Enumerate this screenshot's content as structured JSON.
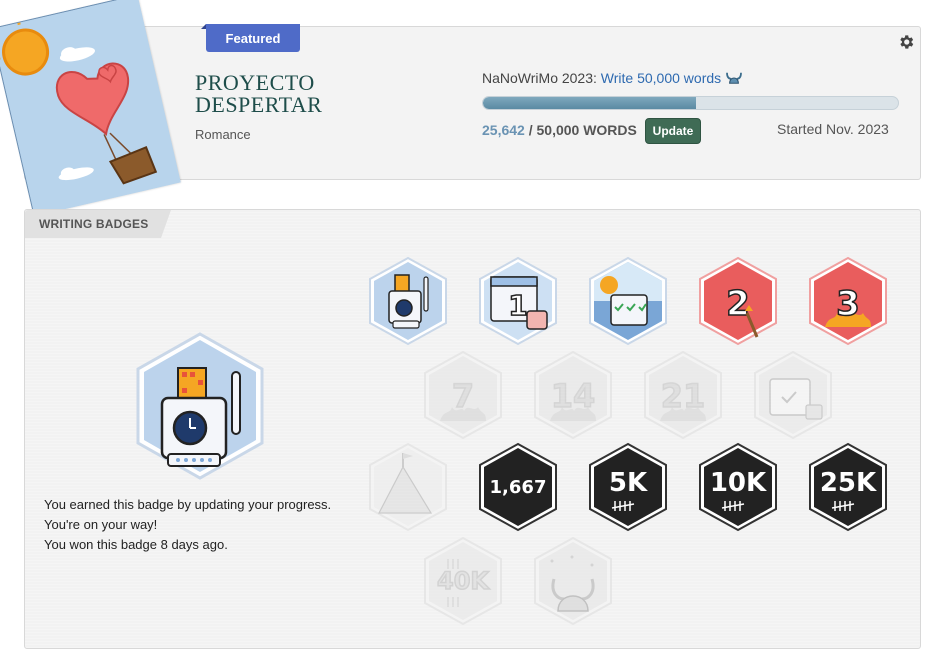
{
  "project": {
    "featured_label": "Featured",
    "title_line1": "PROYECTO",
    "title_line2": "DESPERTAR",
    "genre": "Romance",
    "goal_event": "NaNoWriMo 2023: ",
    "goal_text": "Write 50,000 words",
    "progress_fraction": 0.513,
    "current_words": "25,642",
    "goal_words": " / 50,000 WORDS",
    "update_label": "Update",
    "started": "Started Nov. 2023"
  },
  "badges_section": {
    "header": "WRITING BADGES",
    "selected_description": [
      "You earned this badge by updating your progress.",
      "You're on your way!",
      "You won this badge 8 days ago."
    ],
    "badges": [
      {
        "name": "update-progress-badge",
        "label": "",
        "earned": true,
        "theme": "slot"
      },
      {
        "name": "day-1-badge",
        "label": "1",
        "earned": true,
        "theme": "calendar"
      },
      {
        "name": "calendar-check-badge",
        "label": "",
        "earned": true,
        "theme": "scene"
      },
      {
        "name": "streak-2-badge",
        "label": "2",
        "earned": true,
        "theme": "red"
      },
      {
        "name": "streak-3-badge",
        "label": "3",
        "earned": true,
        "theme": "red-flame"
      },
      {
        "name": "streak-7-badge",
        "label": "7",
        "earned": false,
        "theme": "grey-flame"
      },
      {
        "name": "streak-14-badge",
        "label": "14",
        "earned": false,
        "theme": "grey-flame"
      },
      {
        "name": "streak-21-badge",
        "label": "21",
        "earned": false,
        "theme": "grey-flame"
      },
      {
        "name": "calendar-complete-badge",
        "label": "",
        "earned": false,
        "theme": "grey-calendar"
      },
      {
        "name": "mountain-flag-badge",
        "label": "",
        "earned": false,
        "theme": "grey-mountain"
      },
      {
        "name": "words-1667-badge",
        "label": "1,667",
        "earned": true,
        "theme": "dark"
      },
      {
        "name": "words-5k-badge",
        "label": "5K",
        "earned": true,
        "theme": "dark"
      },
      {
        "name": "words-10k-badge",
        "label": "10K",
        "earned": true,
        "theme": "dark"
      },
      {
        "name": "words-25k-badge",
        "label": "25K",
        "earned": true,
        "theme": "dark"
      },
      {
        "name": "words-40k-badge",
        "label": "40K",
        "earned": false,
        "theme": "grey-dark"
      },
      {
        "name": "viking-helmet-badge",
        "label": "",
        "earned": false,
        "theme": "grey-viking"
      }
    ]
  },
  "colors": {
    "accent_blue": "#4f6bc8",
    "title_green": "#1e4d4a",
    "update_green": "#3f6b55",
    "badge_red": "#e95d5d",
    "badge_dark": "#222222"
  }
}
